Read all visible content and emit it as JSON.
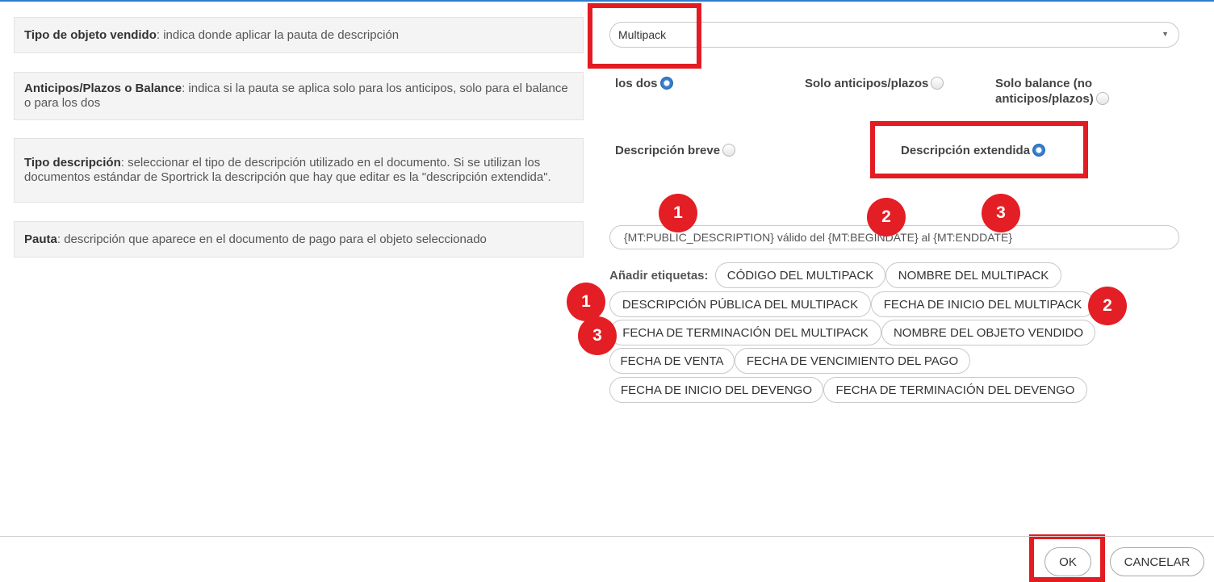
{
  "rows": [
    {
      "bold": "Tipo de objeto vendido",
      "text": ": indica donde aplicar la pauta de descripción"
    },
    {
      "bold": "Anticipos/Plazos o Balance",
      "text": ": indica si la pauta se aplica solo para los anticipos, solo para el balance o para los dos"
    },
    {
      "bold": "Tipo descripción",
      "text": ": seleccionar el tipo de descripción utilizado en el documento. Si se utilizan los documentos estándar de Sportrick la descripción que hay que editar es la \"descripción extendida\"."
    },
    {
      "bold": "Pauta",
      "text": ": descripción que aparece en el documento de pago para el objeto seleccionado"
    }
  ],
  "object_type": {
    "value": "Multipack"
  },
  "payment_scope": {
    "options": [
      "los dos",
      "Solo anticipos/plazos",
      "Solo balance (no anticipos/plazos)"
    ],
    "selected": "los dos"
  },
  "description_type": {
    "options": [
      "Descripción breve",
      "Descripción extendida"
    ],
    "selected": "Descripción extendida"
  },
  "pattern": {
    "value": "{MT:PUBLIC_DESCRIPTION} válido del {MT:BEGINDATE} al {MT:ENDDATE}"
  },
  "tags": {
    "label": "Añadir etiquetas:",
    "items": [
      "CÓDIGO DEL MULTIPACK",
      "NOMBRE DEL MULTIPACK",
      "DESCRIPCIÓN PÚBLICA DEL MULTIPACK",
      "FECHA DE INICIO DEL MULTIPACK",
      "FECHA DE TERMINACIÓN DEL MULTIPACK",
      "NOMBRE DEL OBJETO VENDIDO",
      "FECHA DE VENTA",
      "FECHA DE VENCIMIENTO DEL PAGO",
      "FECHA DE INICIO DEL DEVENGO",
      "FECHA DE TERMINACIÓN DEL DEVENGO"
    ]
  },
  "badges": [
    "1",
    "2",
    "3",
    "1",
    "2",
    "3"
  ],
  "buttons": {
    "ok": "OK",
    "cancel": "CANCELAR"
  },
  "colors": {
    "accent": "#2f7fd0",
    "highlight": "#e21c22",
    "radio_selected": "#2d6fbd"
  }
}
